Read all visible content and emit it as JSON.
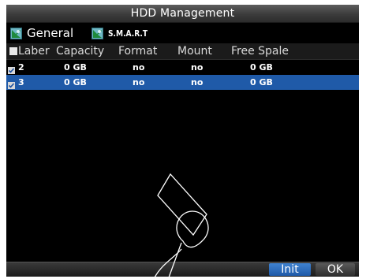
{
  "window": {
    "title": "HDD Management"
  },
  "tabs": [
    {
      "label": "General",
      "icon": "hdd-icon"
    },
    {
      "label": "S.M.A.R.T",
      "icon": "hdd-icon"
    }
  ],
  "table": {
    "columns": [
      "Laber",
      "Capacity",
      "Format",
      "Mount",
      "Free Spale"
    ],
    "rows": [
      {
        "checked": true,
        "label": "2",
        "capacity": "0 GB",
        "format": "no",
        "mount": "no",
        "free_space": "0 GB",
        "selected": false
      },
      {
        "checked": true,
        "label": "3",
        "capacity": "0 GB",
        "format": "no",
        "mount": "no",
        "free_space": "0 GB",
        "selected": true
      }
    ]
  },
  "footer": {
    "init_label": "Init",
    "ok_label": "OK"
  },
  "colors": {
    "selection": "#1f5aa8",
    "background": "#000000",
    "titlebar": "#3c3c3c"
  }
}
